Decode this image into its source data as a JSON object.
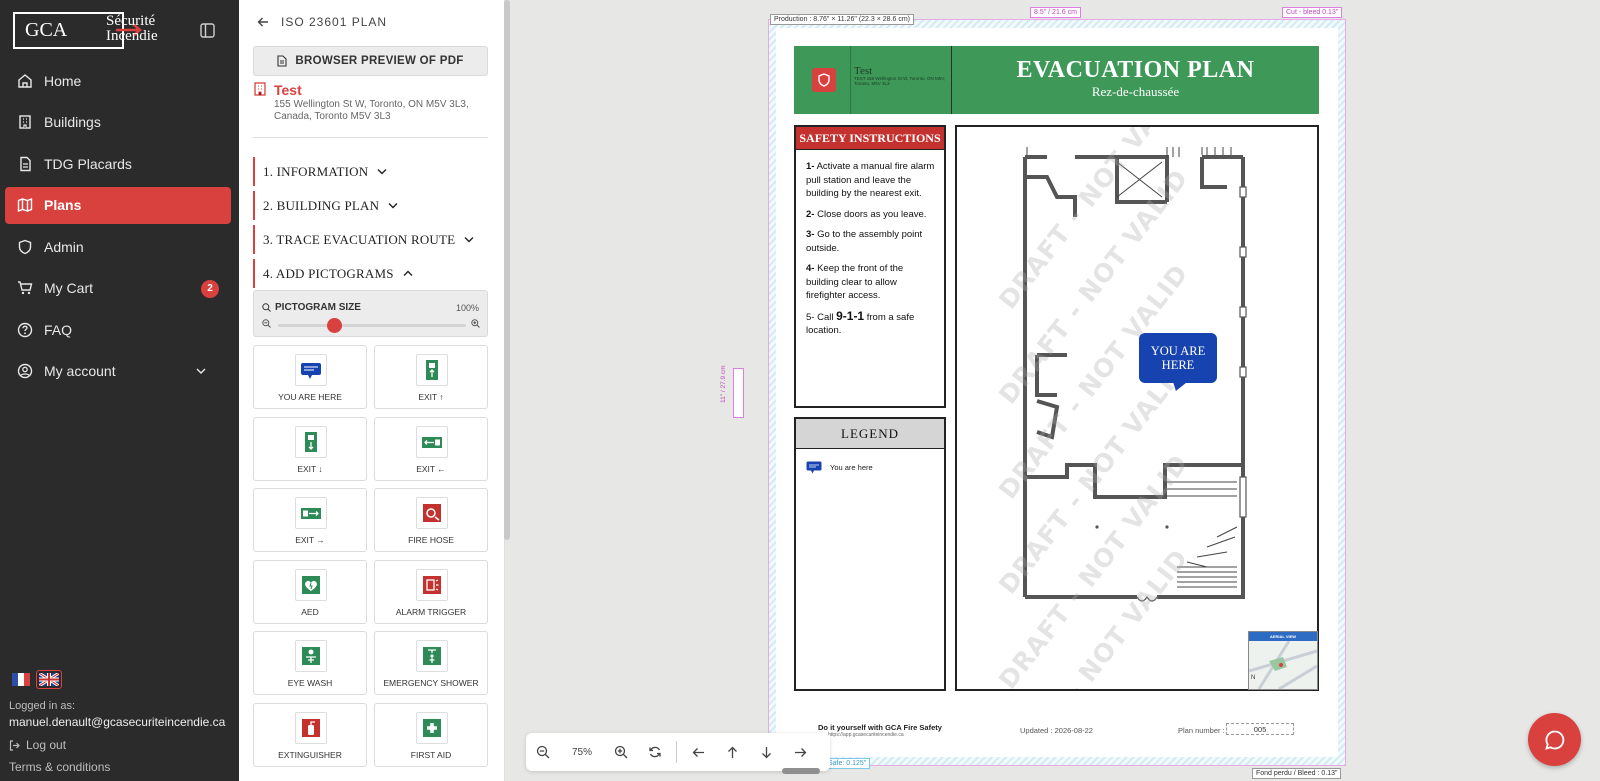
{
  "brand": {
    "logo_abbr": "GCA",
    "logo_name_line1": "Sécurité",
    "logo_name_line2": "Incendie",
    "accent_color": "#d8413e"
  },
  "nav": {
    "items": [
      {
        "label": "Home",
        "icon": "home-icon"
      },
      {
        "label": "Buildings",
        "icon": "building-icon"
      },
      {
        "label": "TDG Placards",
        "icon": "document-icon"
      },
      {
        "label": "Plans",
        "icon": "map-icon",
        "active": true
      },
      {
        "label": "Admin",
        "icon": "shield-icon"
      },
      {
        "label": "My Cart",
        "icon": "cart-icon",
        "badge": "2"
      },
      {
        "label": "FAQ",
        "icon": "help-icon"
      },
      {
        "label": "My account",
        "icon": "user-circle-icon"
      }
    ]
  },
  "footer": {
    "logged_label": "Logged in as:",
    "email": "manuel.denault@gcasecuriteincendie.ca",
    "logout": "Log out",
    "terms": "Terms & conditions"
  },
  "panel": {
    "header": "ISO 23601 PLAN",
    "preview_button": "BROWSER PREVIEW OF PDF",
    "building_name": "Test",
    "building_address": "155 Wellington St W, Toronto, ON M5V 3L3, Canada, Toronto M5V 3L3",
    "steps": [
      {
        "label": "1. INFORMATION",
        "expanded": false
      },
      {
        "label": "2. BUILDING PLAN",
        "expanded": false
      },
      {
        "label": "3. TRACE EVACUATION ROUTE",
        "expanded": false
      },
      {
        "label": "4. ADD PICTOGRAMS",
        "expanded": true
      }
    ],
    "pictogram_size_label": "PICTOGRAM SIZE",
    "pictogram_size_value": "100%",
    "pictogram_size_fraction": 0.3,
    "pictograms": [
      {
        "label": "YOU ARE HERE",
        "icon": "you-are-here-icon",
        "color": "#1743b0"
      },
      {
        "label": "EXIT ↑",
        "icon": "exit-up-icon",
        "color": "#2e8b57"
      },
      {
        "label": "EXIT ↓",
        "icon": "exit-down-icon",
        "color": "#2e8b57"
      },
      {
        "label": "EXIT ←",
        "icon": "exit-left-icon",
        "color": "#2e8b57"
      },
      {
        "label": "EXIT →",
        "icon": "exit-right-icon",
        "color": "#2e8b57"
      },
      {
        "label": "FIRE HOSE",
        "icon": "fire-hose-icon",
        "color": "#c4322f"
      },
      {
        "label": "AED",
        "icon": "aed-icon",
        "color": "#2e8b57"
      },
      {
        "label": "ALARM TRIGGER",
        "icon": "alarm-trigger-icon",
        "color": "#c4322f"
      },
      {
        "label": "EYE WASH",
        "icon": "eye-wash-icon",
        "color": "#2e8b57"
      },
      {
        "label": "EMERGENCY SHOWER",
        "icon": "emergency-shower-icon",
        "color": "#2e8b57"
      },
      {
        "label": "EXTINGUISHER",
        "icon": "extinguisher-icon",
        "color": "#c4322f"
      },
      {
        "label": "FIRST AID",
        "icon": "first-aid-icon",
        "color": "#2e8b57"
      }
    ]
  },
  "document": {
    "production_label": "Production : 8.76\" × 11.26\" (22.3 × 28.6 cm)",
    "width_label": "8.5\" / 21.6 cm",
    "height_label": "11\" / 27.9 cm",
    "cut_label": "Cut - bleed 0.13\"",
    "safe_label": "Safe: 0.125\"",
    "bleed_label": "Fond perdu / Bleed : 0.13\"",
    "building_name": "Test",
    "building_sub": "TEST 155 Wellington St W, Toronto, ON M5V, Toronto, M5V 3L3",
    "title": "EVACUATION PLAN",
    "floor": "Rez-de-chaussée",
    "safety_title": "SAFETY INSTRUCTIONS",
    "safety": [
      {
        "num": "1-",
        "text": "Activate a manual fire alarm pull station and leave the building by the nearest exit."
      },
      {
        "num": "2-",
        "text": "Close doors as you leave."
      },
      {
        "num": "3-",
        "text": "Go to the assembly point outside."
      },
      {
        "num": "4-",
        "text": "Keep the front of the building clear to allow firefighter access."
      }
    ],
    "safety5_pre": "5- Call",
    "safety5_num": "9-1-1",
    "safety5_post": "from a safe location.",
    "legend_title": "LEGEND",
    "legend_item": "You are here",
    "watermark": "DRAFT - NOT VALID",
    "you_are_here": "YOU ARE HERE",
    "aerial_label": "AERIAL VIEW",
    "footer_diy": "Do it yourself with GCA Fire Safety",
    "footer_url": "https://app.gcasecuriteincendie.ca",
    "updated": "Updated : 2026-08-22",
    "plan_number_label": "Plan number :",
    "plan_number": "005"
  },
  "toolbar": {
    "zoom": "75%"
  }
}
